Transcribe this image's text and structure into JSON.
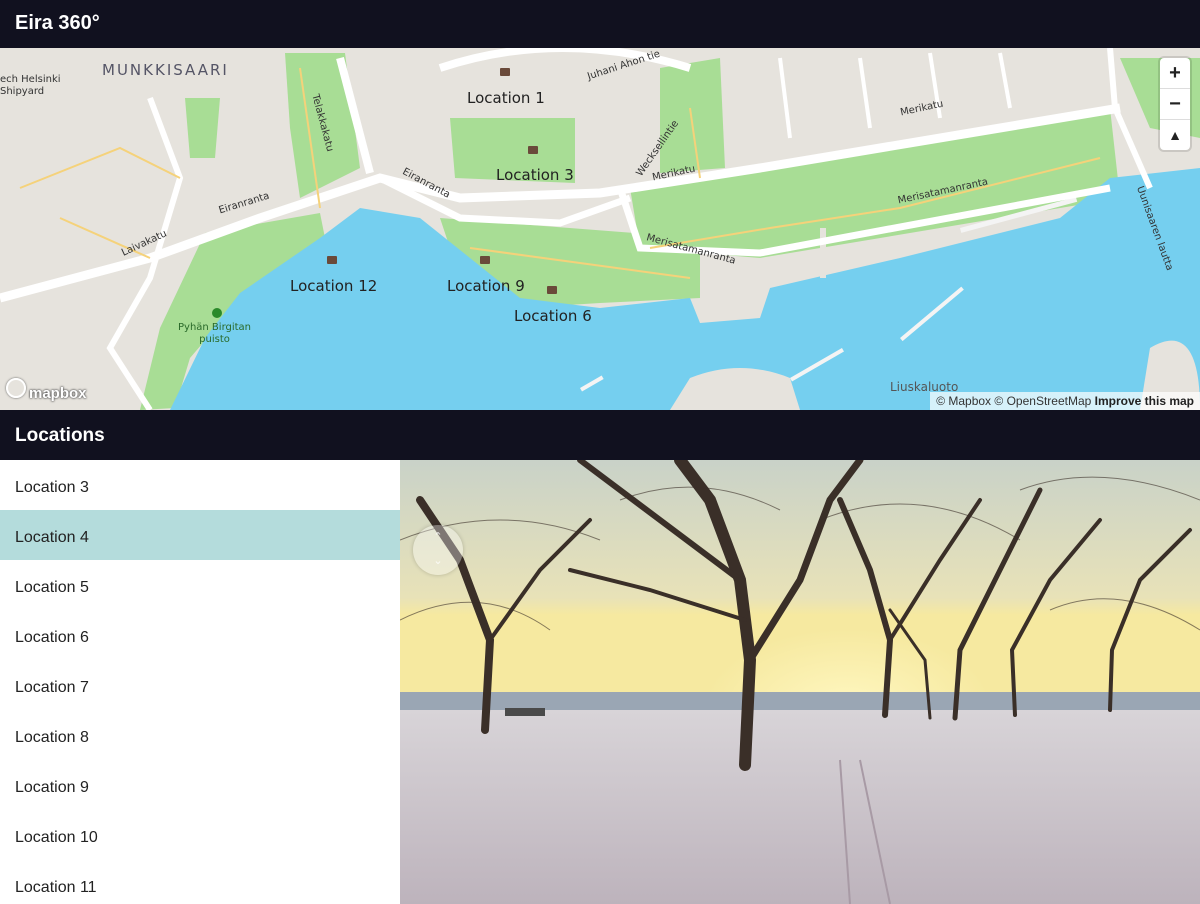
{
  "app": {
    "title": "Eira 360°"
  },
  "map": {
    "district_label": "MUNKKISAARI",
    "shipyard_label": "ech Helsinki\nShipyard",
    "park_label": "Pyhän Birgitan\npuisto",
    "streets": {
      "telakkakatu": "Telakkakatu",
      "eiranranta_1": "Eiranranta",
      "eiranranta_2": "Eiranranta",
      "laivakatu": "Laivakatu",
      "merikatu_1": "Merikatu",
      "merikatu_2": "Merikatu",
      "merisatamanranta_1": "Merisatamanranta",
      "merisatamanranta_2": "Merisatamanranta",
      "wecksellintie": "Wecksellintie",
      "juhani_aho": "Juhani Ahon tie",
      "uunisaaren_lautta": "Uunisaaren lautta",
      "liuskaluoto": "Liuskaluoto"
    },
    "markers": [
      {
        "label": "Location 1"
      },
      {
        "label": "Location 3"
      },
      {
        "label": "Location 12"
      },
      {
        "label": "Location 9"
      },
      {
        "label": "Location 6"
      }
    ],
    "controls": {
      "zoom_in": "+",
      "zoom_out": "−",
      "compass": "▲"
    },
    "logo": "mapbox",
    "attribution": {
      "mapbox": "© Mapbox",
      "osm": "© OpenStreetMap",
      "improve": "Improve this map"
    },
    "colors": {
      "water": "#75cfef",
      "park": "#a8dd95",
      "land": "#e6e3dd",
      "road": "#ffffff",
      "minor_road": "#f5d27a"
    }
  },
  "locations_panel": {
    "title": "Locations",
    "items": [
      {
        "label": "Location 3",
        "active": false
      },
      {
        "label": "Location 4",
        "active": true
      },
      {
        "label": "Location 5",
        "active": false
      },
      {
        "label": "Location 6",
        "active": false
      },
      {
        "label": "Location 7",
        "active": false
      },
      {
        "label": "Location 8",
        "active": false
      },
      {
        "label": "Location 9",
        "active": false
      },
      {
        "label": "Location 10",
        "active": false
      },
      {
        "label": "Location 11",
        "active": false
      }
    ],
    "active_color": "#b4dcdc"
  },
  "panorama": {
    "compass_icon": "compass-rose-icon"
  }
}
